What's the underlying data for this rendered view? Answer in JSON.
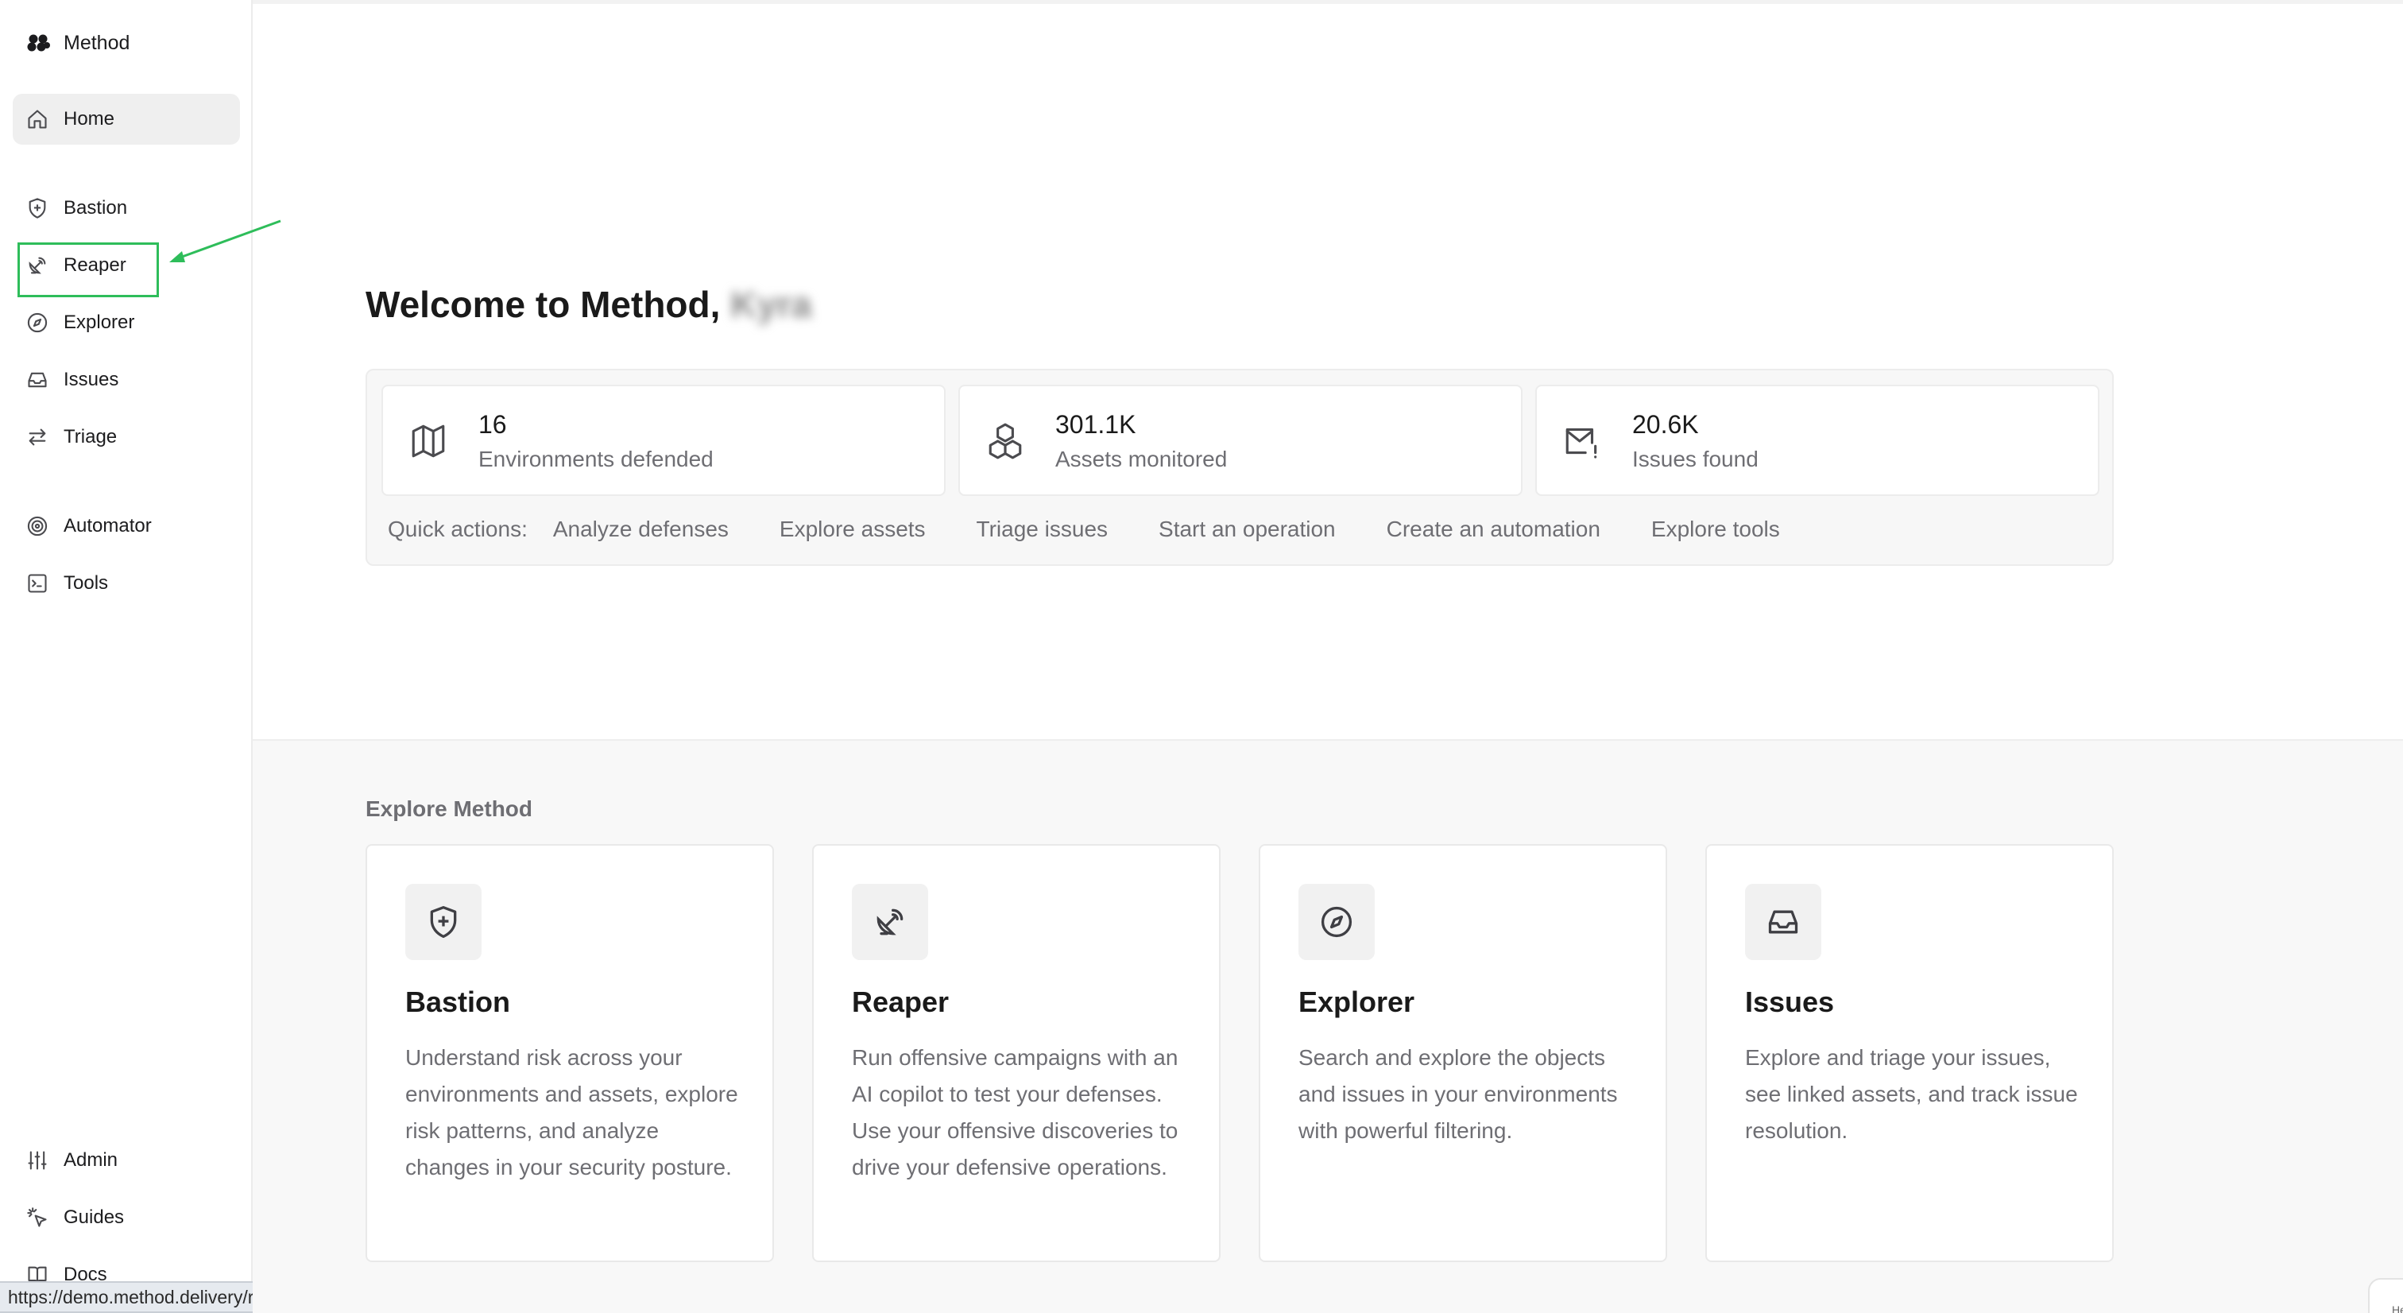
{
  "app": {
    "name": "Method",
    "status_url": "https://demo.method.delivery/reaper"
  },
  "sidebar": {
    "items": [
      {
        "label": "Home",
        "icon": "home-icon",
        "active": true
      },
      {
        "label": "Bastion",
        "icon": "shield-plus-icon"
      },
      {
        "label": "Reaper",
        "icon": "satellite-dish-icon"
      },
      {
        "label": "Explorer",
        "icon": "compass-icon"
      },
      {
        "label": "Issues",
        "icon": "inbox-icon"
      },
      {
        "label": "Triage",
        "icon": "arrows-left-right-icon"
      },
      {
        "label": "Automator",
        "icon": "radar-icon"
      },
      {
        "label": "Tools",
        "icon": "terminal-square-icon"
      },
      {
        "label": "Admin",
        "icon": "sliders-icon"
      },
      {
        "label": "Guides",
        "icon": "sparkle-pointer-icon"
      },
      {
        "label": "Docs",
        "icon": "book-icon"
      }
    ]
  },
  "main": {
    "welcome_prefix": "Welcome to Method,",
    "welcome_name": "Kyra",
    "stats": [
      {
        "value": "16",
        "label": "Environments defended",
        "icon": "map-icon"
      },
      {
        "value": "301.1K",
        "label": "Assets monitored",
        "icon": "boxes-icon"
      },
      {
        "value": "20.6K",
        "label": "Issues found",
        "icon": "mail-alert-icon"
      }
    ],
    "quick_actions": {
      "label": "Quick actions:",
      "items": [
        "Analyze defenses",
        "Explore assets",
        "Triage issues",
        "Start an operation",
        "Create an automation",
        "Explore tools"
      ]
    },
    "explore": {
      "title": "Explore Method",
      "cards": [
        {
          "title": "Bastion",
          "icon": "shield-plus-icon",
          "description": "Understand risk across your environments and assets, explore risk patterns, and analyze changes in your security posture."
        },
        {
          "title": "Reaper",
          "icon": "satellite-dish-icon",
          "description": "Run offensive campaigns with an AI copilot to test your defenses. Use your offensive discoveries to drive your defensive operations."
        },
        {
          "title": "Explorer",
          "icon": "compass-icon",
          "description": "Search and explore the objects and issues in your environments with powerful filtering."
        },
        {
          "title": "Issues",
          "icon": "inbox-icon",
          "description": "Explore and triage your issues, see linked assets, and track issue resolution."
        }
      ]
    },
    "corner_text": "He"
  },
  "colors": {
    "annotation": "#2ebd5a",
    "active_nav_bg": "#efefef",
    "muted_text": "#6e6e73"
  }
}
